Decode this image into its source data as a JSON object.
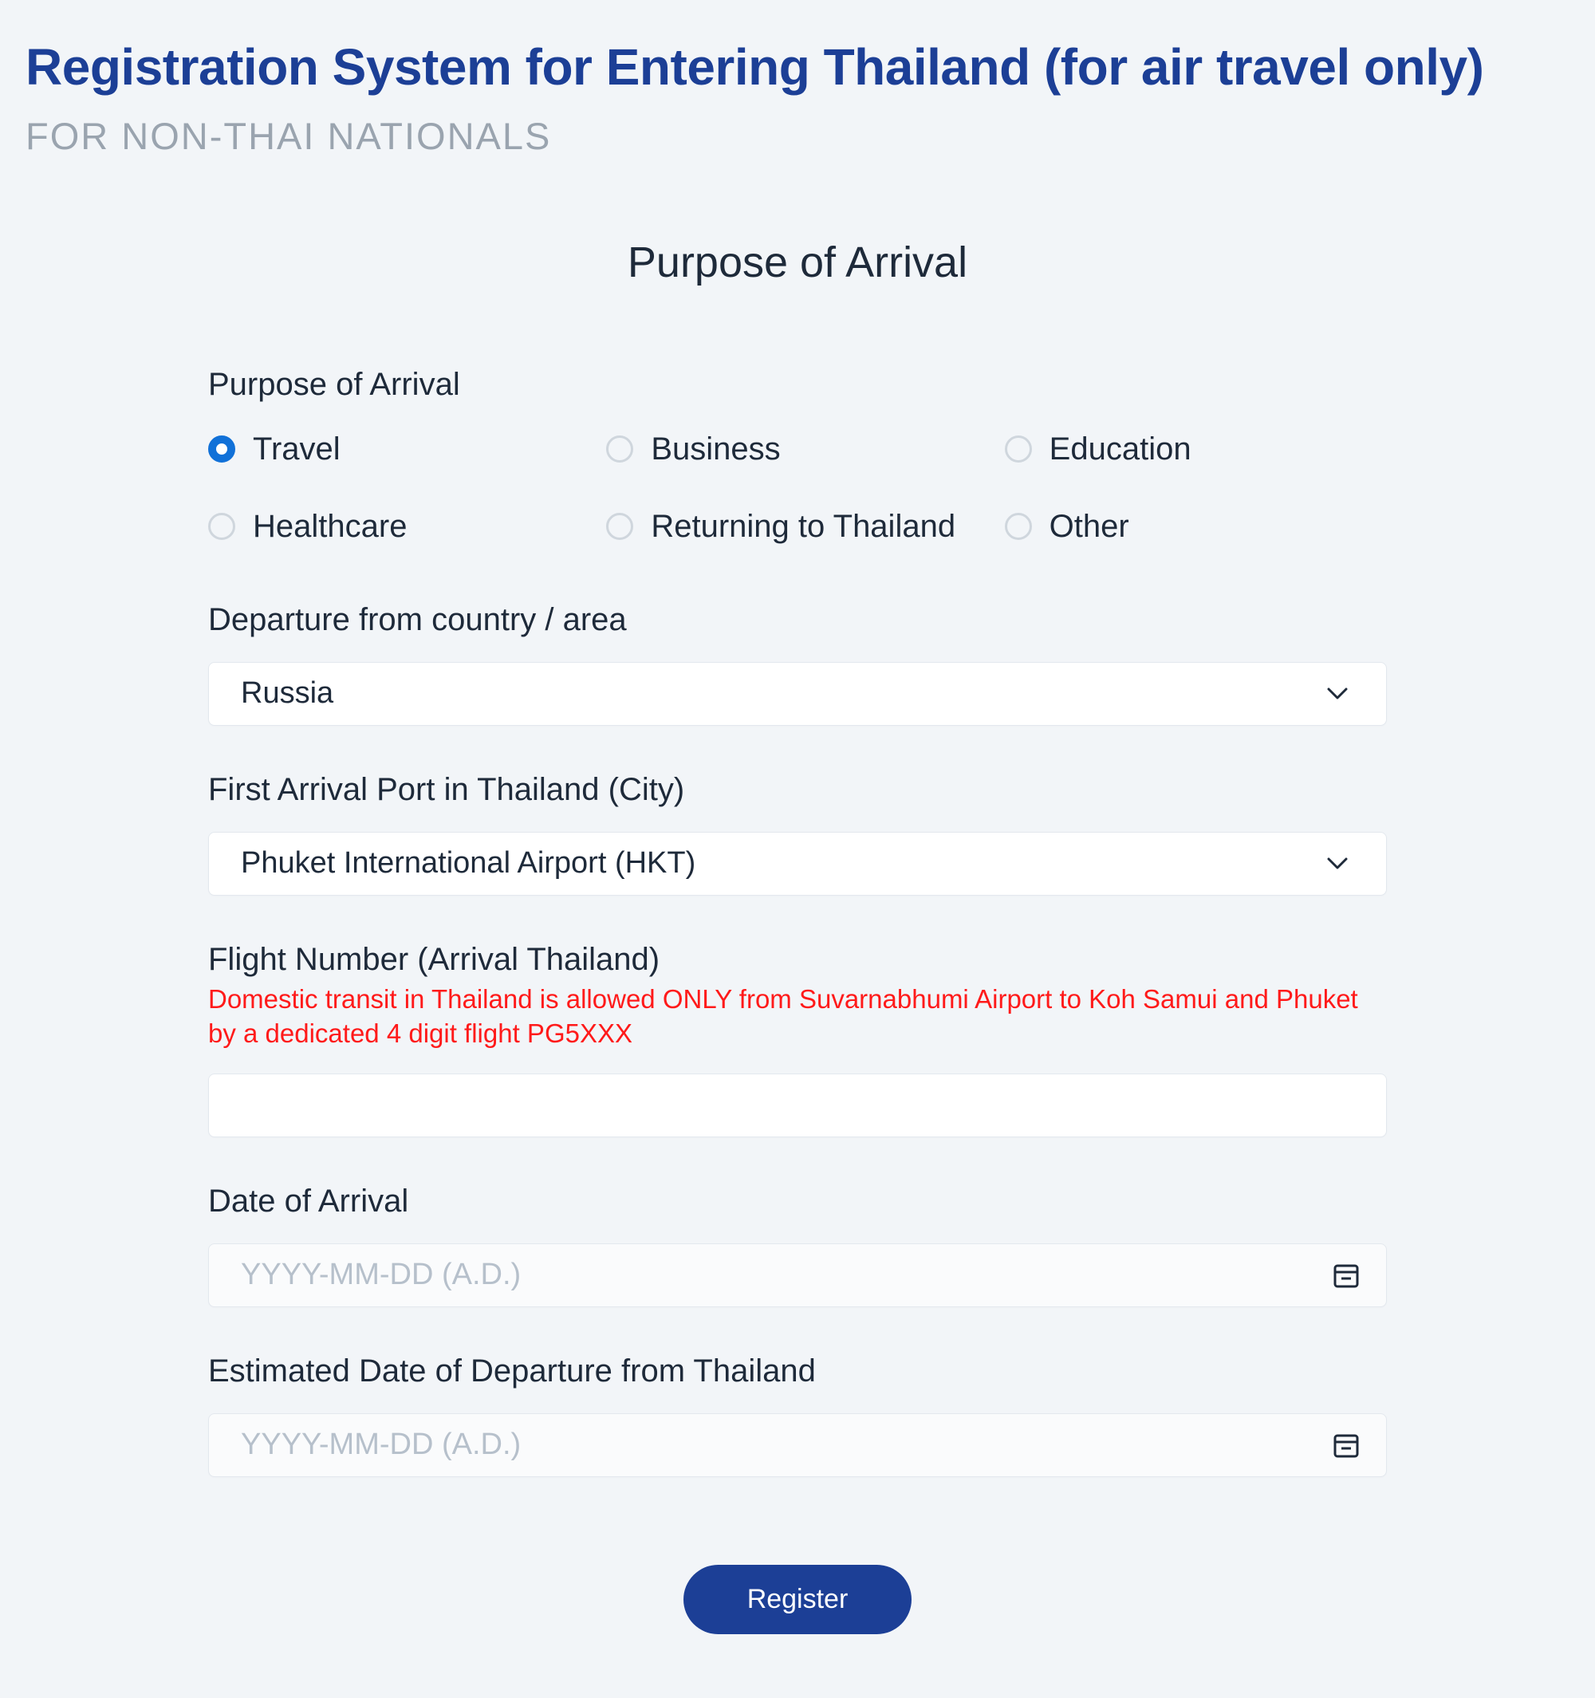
{
  "header": {
    "title": "Registration System for Entering Thailand (for air travel only)",
    "subtitle": "FOR NON-THAI NATIONALS"
  },
  "section_heading": "Purpose of Arrival",
  "purpose": {
    "label": "Purpose of Arrival",
    "selected": "Travel",
    "options": [
      "Travel",
      "Business",
      "Education",
      "Healthcare",
      "Returning to Thailand",
      "Other"
    ]
  },
  "departure": {
    "label": "Departure from country / area",
    "value": "Russia"
  },
  "arrival_port": {
    "label": "First Arrival Port in Thailand (City)",
    "value": "Phuket International Airport (HKT)"
  },
  "flight": {
    "label": "Flight Number (Arrival Thailand)",
    "warning": "Domestic transit in Thailand is allowed ONLY from Suvarnabhumi Airport to Koh Samui and Phuket by a dedicated 4 digit flight PG5XXX",
    "value": ""
  },
  "arrival_date": {
    "label": "Date of Arrival",
    "placeholder": "YYYY-MM-DD (A.D.)",
    "value": ""
  },
  "departure_date": {
    "label": "Estimated Date of Departure from Thailand",
    "placeholder": "YYYY-MM-DD (A.D.)",
    "value": ""
  },
  "register_label": "Register"
}
